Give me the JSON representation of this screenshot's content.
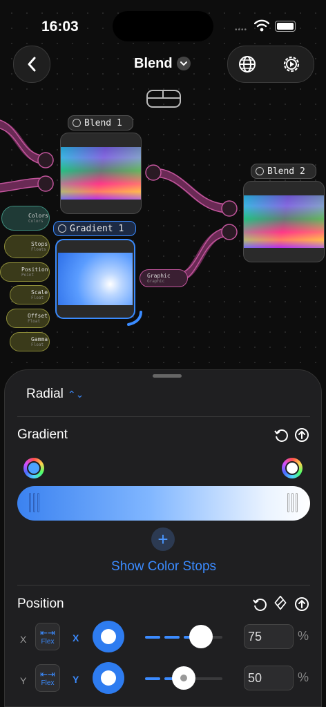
{
  "status": {
    "time": "16:03"
  },
  "nav": {
    "title": "Blend"
  },
  "nodes": {
    "blend1": {
      "label": "Blend 1"
    },
    "blend2": {
      "label": "Blend 2"
    },
    "gradient1": {
      "label": "Gradient 1"
    },
    "graphic_port": {
      "label": "Graphic",
      "sub": "Graphic"
    },
    "inputs": [
      {
        "label": "Colors",
        "sub": "Colors"
      },
      {
        "label": "Stops",
        "sub": "Floats"
      },
      {
        "label": "Position",
        "sub": "Point"
      },
      {
        "label": "Scale",
        "sub": "Float"
      },
      {
        "label": "Offset",
        "sub": "Float"
      },
      {
        "label": "Gamma",
        "sub": "Float"
      }
    ]
  },
  "sheet": {
    "mode": "Radial",
    "gradient_title": "Gradient",
    "show_color_stops": "Show Color Stops",
    "position_title": "Position",
    "x": {
      "axis": "X",
      "flex_label": "Flex",
      "knob_label": "X",
      "value": "75",
      "unit": "%",
      "slider_fraction": 0.72
    },
    "y": {
      "axis": "Y",
      "flex_label": "Flex",
      "knob_label": "Y",
      "value": "50",
      "unit": "%",
      "slider_fraction": 0.5
    }
  },
  "colors": {
    "accent": "#3b8bff",
    "selection": "#3a8bff",
    "wire": "#b24d8c"
  }
}
